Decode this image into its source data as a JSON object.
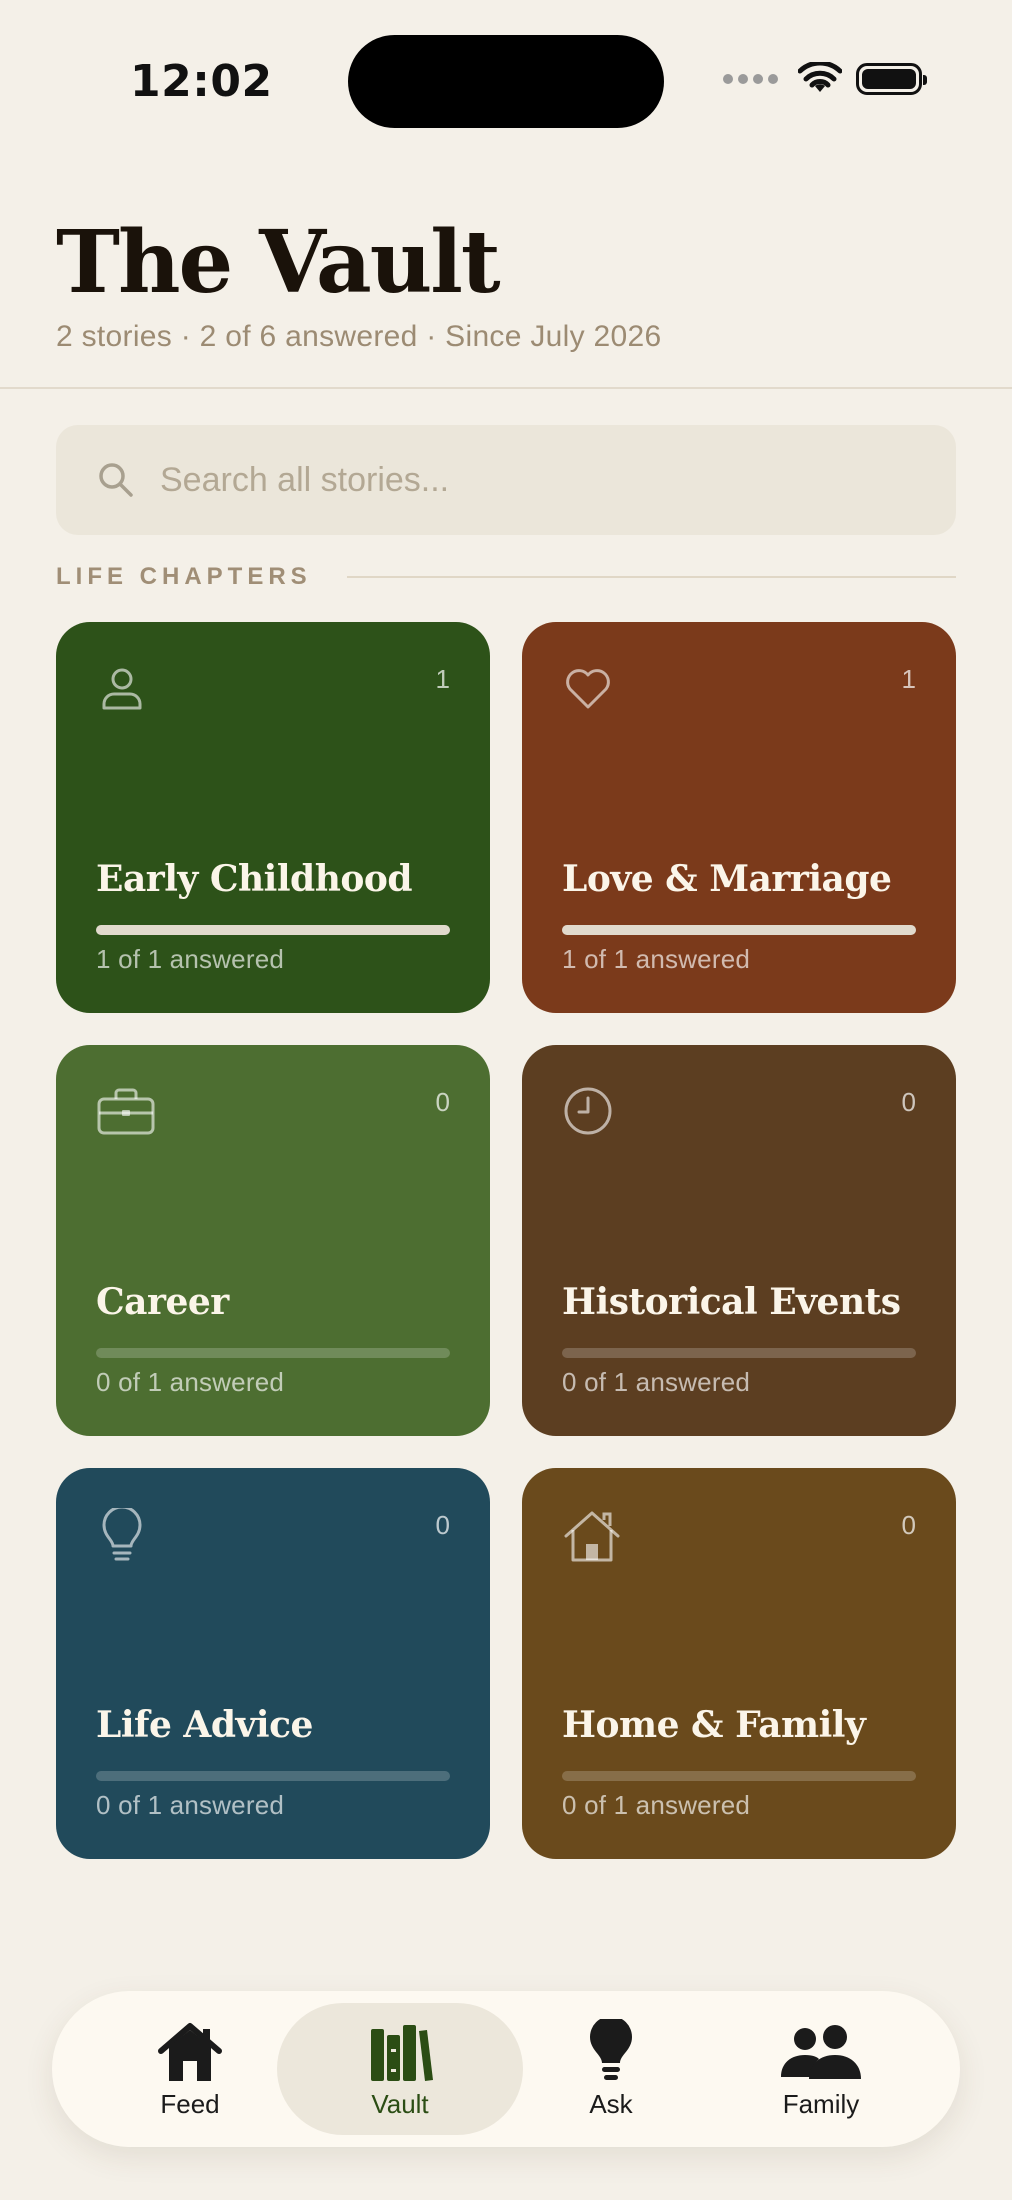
{
  "status_bar": {
    "time": "12:02"
  },
  "header": {
    "title": "The Vault",
    "subtitle": "2 stories · 2 of 6 answered · Since July 2026"
  },
  "search": {
    "placeholder": "Search all stories..."
  },
  "section": {
    "label": "LIFE CHAPTERS"
  },
  "chapters": [
    {
      "title": "Early Childhood",
      "count": "1",
      "subtitle": "1 of 1 answered",
      "progress": 1.0,
      "icon": "person-icon",
      "color": "#2D5219"
    },
    {
      "title": "Love & Marriage",
      "count": "1",
      "subtitle": "1 of 1 answered",
      "progress": 1.0,
      "icon": "heart-icon",
      "color": "#7B3A1B"
    },
    {
      "title": "Career",
      "count": "0",
      "subtitle": "0 of 1 answered",
      "progress": 0.0,
      "icon": "briefcase-icon",
      "color": "#4D6E31"
    },
    {
      "title": "Historical Events",
      "count": "0",
      "subtitle": "0 of 1 answered",
      "progress": 0.0,
      "icon": "clock-icon",
      "color": "#5C3E21"
    },
    {
      "title": "Life Advice",
      "count": "0",
      "subtitle": "0 of 1 answered",
      "progress": 0.0,
      "icon": "lightbulb-icon",
      "color": "#214A5B"
    },
    {
      "title": "Home & Family",
      "count": "0",
      "subtitle": "0 of 1 answered",
      "progress": 0.0,
      "icon": "home-icon",
      "color": "#6A4A1C"
    }
  ],
  "tabbar": {
    "items": [
      {
        "label": "Feed",
        "icon": "house-icon",
        "active": false
      },
      {
        "label": "Vault",
        "icon": "books-icon",
        "active": true
      },
      {
        "label": "Ask",
        "icon": "lightbulb-icon",
        "active": false
      },
      {
        "label": "Family",
        "icon": "people-icon",
        "active": false
      }
    ]
  },
  "colors": {
    "background": "#F4F0E8",
    "muted_text": "#9C8B73",
    "active_tab": "#2B4D14"
  }
}
